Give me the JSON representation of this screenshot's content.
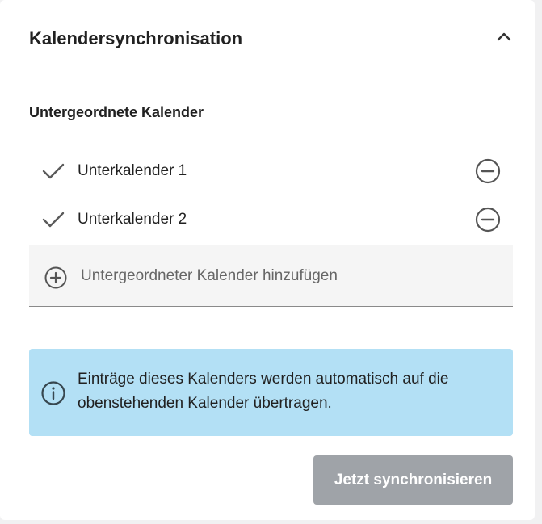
{
  "panel": {
    "title": "Kalendersynchronisation",
    "collapse_icon": "chevron-up-icon"
  },
  "subcalendars": {
    "heading": "Untergeordnete Kalender",
    "items": [
      {
        "label": "Unterkalender 1",
        "checked": true
      },
      {
        "label": "Unterkalender 2",
        "checked": true
      }
    ],
    "add_label": "Untergeordneter Kalender hinzufügen"
  },
  "info": {
    "text": "Einträge dieses Kalenders werden automatisch auf die obenstehenden Kalender übertragen.",
    "background": "#b3e0f5"
  },
  "actions": {
    "sync_label": "Jetzt synchronisieren",
    "sync_color": "#9fa3a8"
  }
}
